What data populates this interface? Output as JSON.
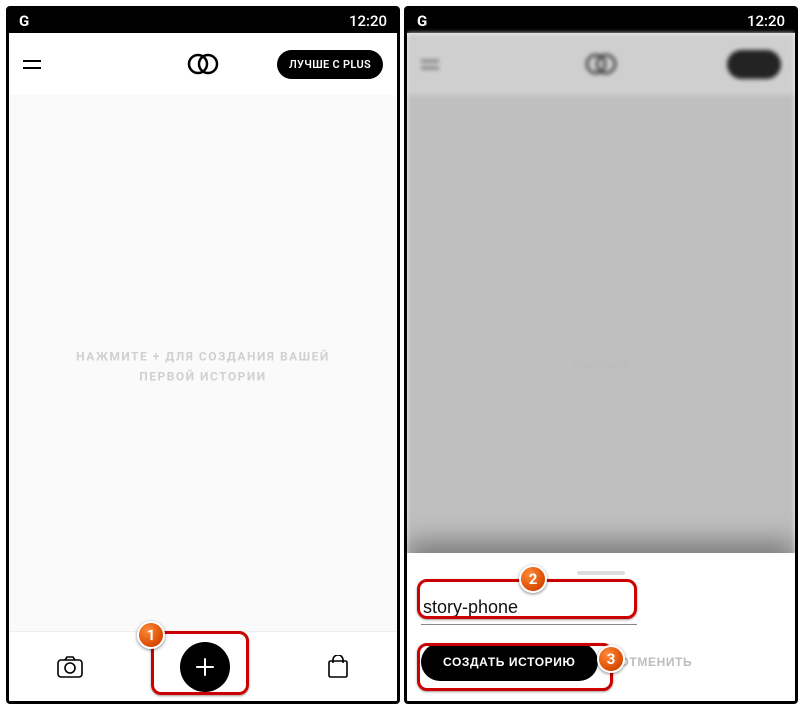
{
  "status": {
    "brand": "G",
    "time": "12:20"
  },
  "left": {
    "plus_label": "ЛУЧШЕ С PLUS",
    "empty_line1": "НАЖМИТЕ + ДЛЯ СОЗДАНИЯ ВАШЕЙ",
    "empty_line2": "ПЕРВОЙ ИСТОРИИ"
  },
  "right": {
    "input_value": "story-phone",
    "create_label": "СОЗДАТЬ ИСТОРИЮ",
    "cancel_label": "ОТМЕНИТЬ"
  },
  "callouts": {
    "one": "1",
    "two": "2",
    "three": "3"
  }
}
